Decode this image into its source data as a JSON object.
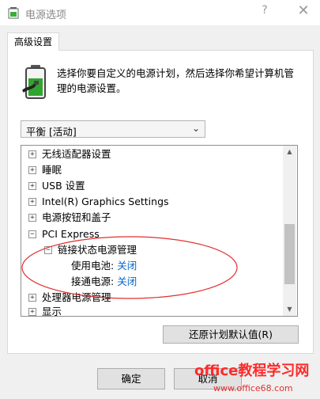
{
  "window": {
    "title": "电源选项",
    "help_glyph": "?",
    "close_glyph": "✕"
  },
  "tab": {
    "label": "高级设置"
  },
  "description": "选择你要自定义的电源计划，然后选择你希望计算机管理的电源设置。",
  "plan_select": {
    "value": "平衡 [活动]"
  },
  "tree": {
    "items": [
      {
        "label": "无线适配器设置",
        "expander": "+",
        "level": 0
      },
      {
        "label": "睡眠",
        "expander": "+",
        "level": 0
      },
      {
        "label": "USB 设置",
        "expander": "+",
        "level": 0
      },
      {
        "label": "Intel(R) Graphics Settings",
        "expander": "+",
        "level": 0
      },
      {
        "label": "电源按钮和盖子",
        "expander": "+",
        "level": 0
      },
      {
        "label": "PCI Express",
        "expander": "−",
        "level": 0
      },
      {
        "label": "链接状态电源管理",
        "expander": "−",
        "level": 1
      },
      {
        "label": "使用电池:",
        "value": "关闭",
        "level": 2
      },
      {
        "label": "接通电源:",
        "value": "关闭",
        "level": 2
      },
      {
        "label": "处理器电源管理",
        "expander": "+",
        "level": 0
      },
      {
        "label": "显示",
        "expander": "+",
        "level": 0
      }
    ]
  },
  "buttons": {
    "restore_defaults": "还原计划默认值(R)",
    "ok": "确定",
    "cancel": "取消"
  },
  "watermark": {
    "main": "office教程学习网",
    "url": "www.office68.com"
  },
  "colors": {
    "link": "#0066cc",
    "highlight_ring": "#e03030",
    "watermark": "#ff2a2a"
  }
}
